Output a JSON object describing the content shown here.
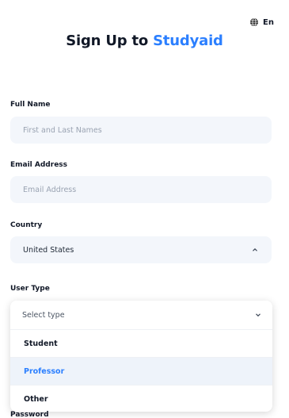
{
  "language": {
    "label": "En"
  },
  "header": {
    "title_prefix": "Sign Up to ",
    "title_brand": "Studyaid"
  },
  "form": {
    "full_name": {
      "label": "Full Name",
      "placeholder": "First and Last Names"
    },
    "email": {
      "label": "Email Address",
      "placeholder": "Email Address"
    },
    "country": {
      "label": "Country",
      "value": "United States"
    },
    "user_type": {
      "label": "User Type",
      "placeholder": "Select type",
      "options": [
        "Student",
        "Professor",
        "Other"
      ],
      "highlighted": "Professor"
    },
    "password": {
      "label": "Password"
    }
  },
  "colors": {
    "brand": "#2b7fff",
    "field_bg": "#f3f6fb"
  },
  "icons": {
    "language": "globe-icon",
    "expand": "chevron-down-icon",
    "collapse": "chevron-up-icon"
  }
}
